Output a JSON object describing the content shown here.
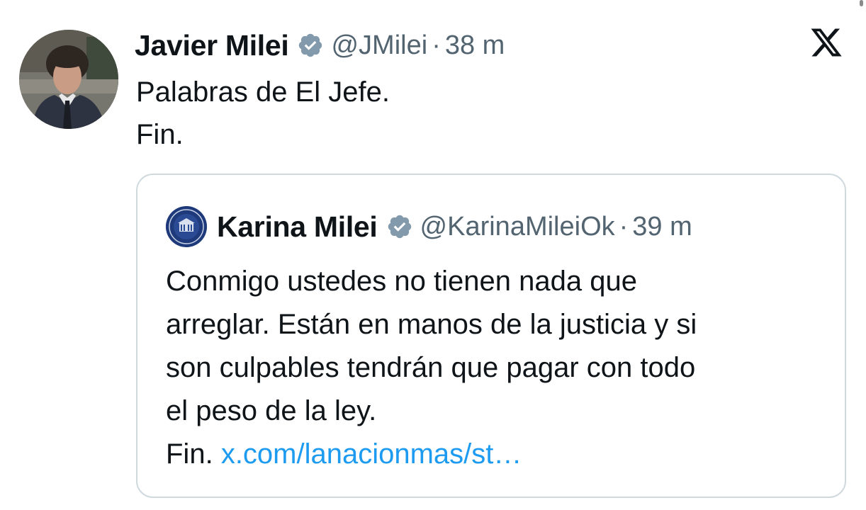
{
  "tweet": {
    "author_name": "Javier Milei",
    "verified_icon": "verified-badge-icon",
    "handle": "@JMilei",
    "separator": "·",
    "time": "38 m",
    "text_lines": [
      "Palabras de El Jefe.",
      "Fin."
    ]
  },
  "platform": {
    "logo_icon": "x-logo-icon"
  },
  "quoted_tweet": {
    "author_name": "Karina Milei",
    "verified_icon": "verified-badge-icon",
    "handle": "@KarinaMileiOk",
    "separator": "·",
    "time": "39 m",
    "text_lines": [
      "Conmigo ustedes no tienen nada que",
      "arreglar. Están en manos de la justicia y si",
      "son culpables tendrán que pagar con todo",
      "el peso de la ley."
    ],
    "last_line_prefix": "Fin.",
    "link_text": "x.com/lanacionmas/st…"
  },
  "colors": {
    "text_primary": "#0f1419",
    "text_secondary": "#536471",
    "link": "#1d9bf0",
    "border": "#cfd9de",
    "verified_badge": "#829aab"
  }
}
